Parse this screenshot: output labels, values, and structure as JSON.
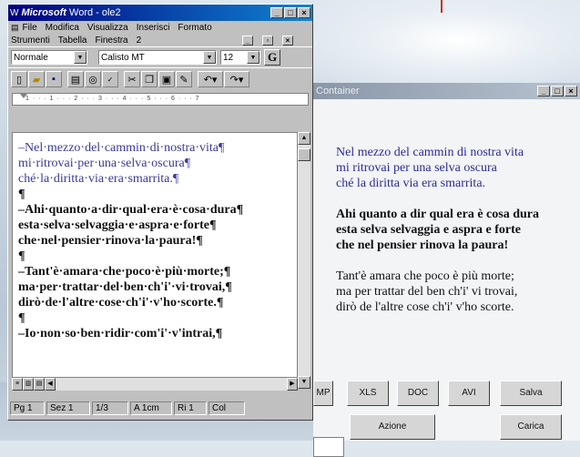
{
  "word": {
    "title_app": "Microsoft",
    "title_rest": "Word - ole2",
    "menu_row1": [
      "File",
      "Modifica",
      "Visualizza",
      "Inserisci",
      "Formato"
    ],
    "menu_row2": [
      "Strumenti",
      "Tabella",
      "Finestra",
      "2"
    ],
    "style": "Normale",
    "font": "Calisto MT",
    "size": "12",
    "ruler_ticks": "1 · · · 1 · · · 2 · · · 3 · · · 4 · · · 5 · · · 6 · · · 7",
    "doc_lines": [
      {
        "text": "–Nel·mezzo·del·cammin·di·nostra·vita¶",
        "style": "p1"
      },
      {
        "text": "mi·ritrovai·per·una·selva·oscura¶",
        "style": "p1"
      },
      {
        "text": "ché·la·diritta·via·era·smarrita.¶",
        "style": "p1"
      },
      {
        "text": "¶",
        "style": "p2"
      },
      {
        "text": "–Ahi·quanto·a·dir·qual·era·è·cosa·dura¶",
        "style": "p2"
      },
      {
        "text": "esta·selva·selvaggia·e·aspra·e·forte¶",
        "style": "p2"
      },
      {
        "text": "che·nel·pensier·rinova·la·paura!¶",
        "style": "p2"
      },
      {
        "text": "¶",
        "style": "p2"
      },
      {
        "text": "–Tant'è·amara·che·poco·è·più·morte;¶",
        "style": "p2"
      },
      {
        "text": "ma·per·trattar·del·ben·ch'i'·vi·trovai,¶",
        "style": "p2"
      },
      {
        "text": "dirò·de·l'altre·cose·ch'i'·v'ho·scorte.¶",
        "style": "p2"
      },
      {
        "text": "¶",
        "style": "p2"
      },
      {
        "text": "–Io·non·so·ben·ridir·com'i'·v'intrai,¶",
        "style": "p2"
      }
    ],
    "status": [
      "Pg 1",
      "Sez 1",
      "1/3",
      "A 1cm",
      "Ri 1",
      "Col"
    ]
  },
  "container": {
    "title": "Container",
    "lines": [
      {
        "text": "Nel mezzo del cammin di nostra vita",
        "style": "p1"
      },
      {
        "text": "mi ritrovai per una selva oscura",
        "style": "p1"
      },
      {
        "text": "ché la diritta via era smarrita.",
        "style": "p1"
      },
      {
        "text": "",
        "style": "gap"
      },
      {
        "text": "Ahi quanto a dir qual era è cosa dura",
        "style": "p2"
      },
      {
        "text": "esta selva selvaggia e aspra e forte",
        "style": "p2"
      },
      {
        "text": "che nel pensier rinova la paura!",
        "style": "p2"
      },
      {
        "text": "",
        "style": "gap"
      },
      {
        "text": "Tant'è amara che poco è più morte;",
        "style": "p3"
      },
      {
        "text": "ma per trattar del ben ch'i' vi trovai,",
        "style": "p3"
      },
      {
        "text": "dirò de l'altre cose ch'i' v'ho scorte.",
        "style": "p3"
      }
    ],
    "buttons": {
      "bmp": "MP",
      "xls": "XLS",
      "doc": "DOC",
      "avi": "AVI",
      "salva": "Salva",
      "azione": "Azione",
      "carica": "Carica"
    }
  }
}
